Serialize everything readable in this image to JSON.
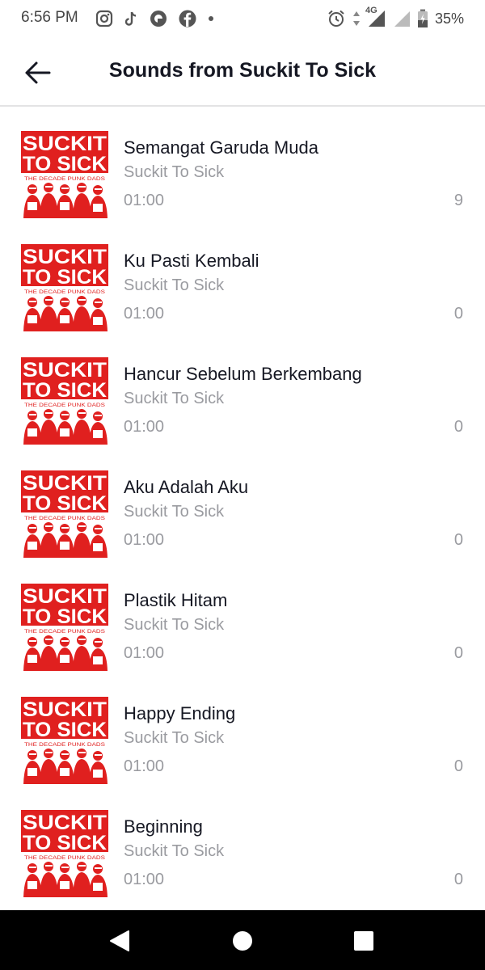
{
  "status_bar": {
    "time": "6:56 PM",
    "network": "4G",
    "battery": "35%",
    "left_icons": [
      "instagram-icon",
      "tiktok-icon",
      "app-circle-icon",
      "facebook-icon",
      "dot-icon"
    ],
    "right_icons": [
      "alarm-icon",
      "data-arrows-icon",
      "signal-icon",
      "signal-empty-icon",
      "battery-icon"
    ]
  },
  "header": {
    "title": "Sounds from Suckit To Sick",
    "back_icon": "arrow-left-icon"
  },
  "cover_art": {
    "line1": "SUCKIT",
    "line2": "TO SICK",
    "tagline": "THE DECADE PUNK DADS",
    "brand_color": "#e0201f"
  },
  "songs": [
    {
      "title": "Semangat Garuda Muda",
      "artist": "Suckit To Sick",
      "duration": "01:00",
      "count": "9"
    },
    {
      "title": "Ku Pasti Kembali",
      "artist": "Suckit To Sick",
      "duration": "01:00",
      "count": "0"
    },
    {
      "title": "Hancur Sebelum Berkembang",
      "artist": "Suckit To Sick",
      "duration": "01:00",
      "count": "0"
    },
    {
      "title": "Aku Adalah Aku",
      "artist": "Suckit To Sick",
      "duration": "01:00",
      "count": "0"
    },
    {
      "title": "Plastik Hitam",
      "artist": "Suckit To Sick",
      "duration": "01:00",
      "count": "0"
    },
    {
      "title": "Happy Ending",
      "artist": "Suckit To Sick",
      "duration": "01:00",
      "count": "0"
    },
    {
      "title": "Beginning",
      "artist": "Suckit To Sick",
      "duration": "01:00",
      "count": "0"
    }
  ],
  "nav_bar": {
    "buttons": [
      "back-triangle-icon",
      "home-circle-icon",
      "recents-square-icon"
    ]
  }
}
